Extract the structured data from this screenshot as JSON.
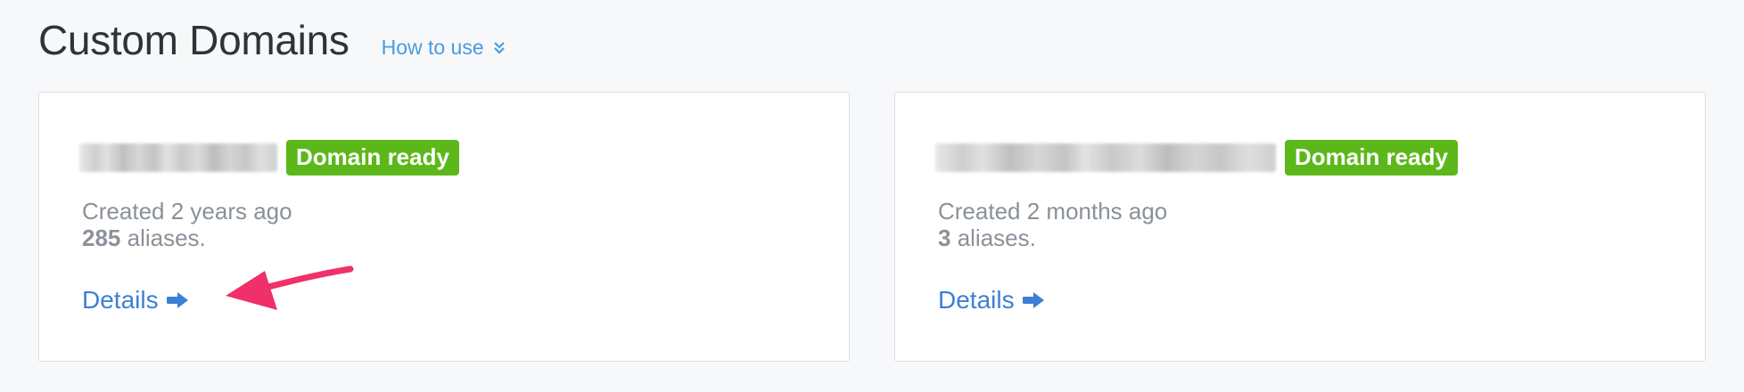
{
  "header": {
    "title": "Custom Domains",
    "how_to_use": "How to use"
  },
  "cards": [
    {
      "status": "Domain ready",
      "created": "Created 2 years ago",
      "alias_count": "285",
      "alias_suffix": " aliases.",
      "details_label": "Details"
    },
    {
      "status": "Domain ready",
      "created": "Created 2 months ago",
      "alias_count": "3",
      "alias_suffix": " aliases.",
      "details_label": "Details"
    }
  ],
  "colors": {
    "badge": "#5cb81a",
    "link": "#3d7fd6",
    "annotation": "#f0306a"
  },
  "icons": {
    "how_to_use": "double-chevron-down-icon",
    "details": "arrow-right-icon"
  }
}
